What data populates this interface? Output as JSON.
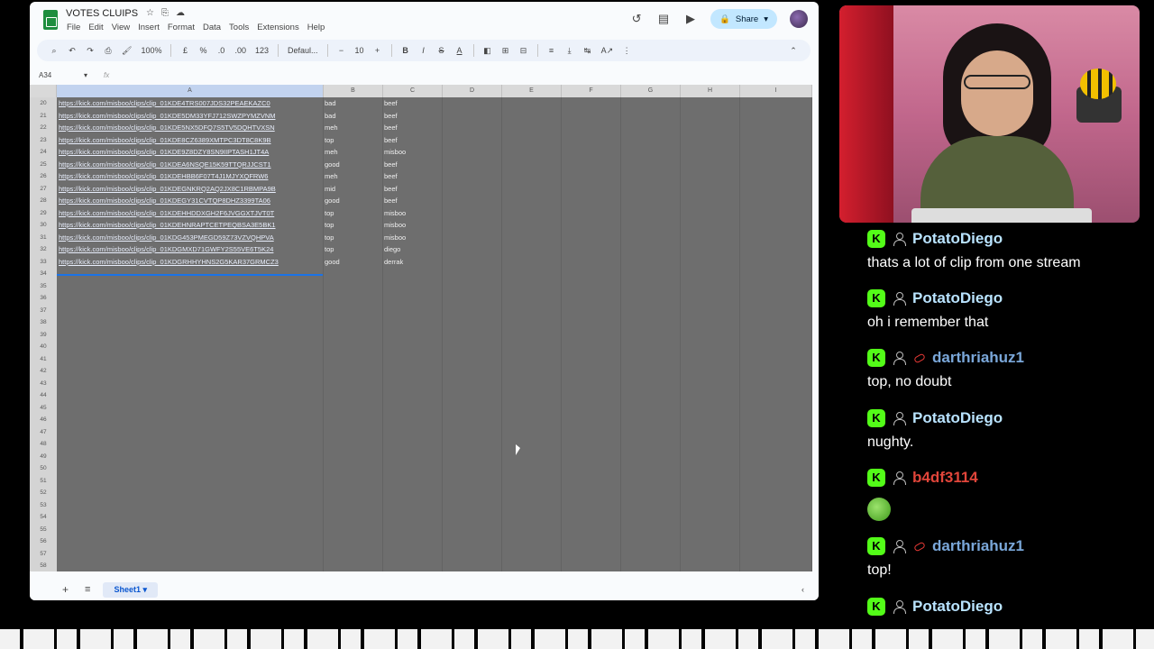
{
  "sheets": {
    "title": "VOTES CLUIPS",
    "menu": [
      "File",
      "Edit",
      "View",
      "Insert",
      "Format",
      "Data",
      "Tools",
      "Extensions",
      "Help"
    ],
    "share_label": "Share",
    "toolbar": {
      "zoom": "100%",
      "currency": "£",
      "percent": "%",
      "dec_decrease": ".0",
      "dec_increase": ".00",
      "number_format": "123",
      "font": "Defaul...",
      "font_minus": "−",
      "font_size": "10",
      "font_plus": "+",
      "bold": "B",
      "italic": "I",
      "strike": "S",
      "text_color": "A"
    },
    "name_box": "A34",
    "fx": "fx",
    "columns": [
      "A",
      "B",
      "C",
      "D",
      "E",
      "F",
      "G",
      "H",
      "I"
    ],
    "rows": [
      {
        "n": "20",
        "url": "https://kick.com/misboo/clips/clip_01KDE4TRS007JDS32PEAEKAZC0",
        "vote": "bad",
        "who": "beef"
      },
      {
        "n": "21",
        "url": "https://kick.com/misboo/clips/clip_01KDE5DM33YFJ712SWZPYMZVNM",
        "vote": "bad",
        "who": "beef"
      },
      {
        "n": "22",
        "url": "https://kick.com/misboo/clips/clip_01KDE5NX5DFQ7S5TV5DQHTVXSN",
        "vote": "meh",
        "who": "beef"
      },
      {
        "n": "23",
        "url": "https://kick.com/misboo/clips/clip_01KDE8CZ6389XMTPC3DT8C8K9B",
        "vote": "top",
        "who": "beef"
      },
      {
        "n": "24",
        "url": "https://kick.com/misboo/clips/clip_01KDE9Z8DZY8SN9IIPTASH1JT4A",
        "vote": "meh",
        "who": "misboo"
      },
      {
        "n": "25",
        "url": "https://kick.com/misboo/clips/clip_01KDEA6NSQE15K59TTQRJJCST1",
        "vote": "good",
        "who": "beef"
      },
      {
        "n": "26",
        "url": "https://kick.com/misboo/clips/clip_01KDEHBB6F07T4J1MJYXQFRW6",
        "vote": "meh",
        "who": "beef"
      },
      {
        "n": "27",
        "url": "https://kick.com/misboo/clips/clip_01KDEGNKRQ2AQ2JX8C1RBMPA9B",
        "vote": "mid",
        "who": "beef"
      },
      {
        "n": "28",
        "url": "https://kick.com/misboo/clips/clip_01KDEGY31CVTQP8DHZ3399TA06",
        "vote": "good",
        "who": "beef"
      },
      {
        "n": "29",
        "url": "https://kick.com/misboo/clips/clip_01KDEHHDDXGH2F6JVGGXTJVT0T",
        "vote": "top",
        "who": "misboo"
      },
      {
        "n": "30",
        "url": "https://kick.com/misboo/clips/clip_01KDEHNRAPTCETPEQBSA3E5BK1",
        "vote": "top",
        "who": "misboo"
      },
      {
        "n": "31",
        "url": "https://kick.com/misboo/clips/clip_01KDG453PMEGD59Z73VZVQHPVA",
        "vote": "top",
        "who": "misboo"
      },
      {
        "n": "32",
        "url": "https://kick.com/misboo/clips/clip_01KDGMXD71GWFY2S55VE6T5K24",
        "vote": "top",
        "who": "diego"
      },
      {
        "n": "33",
        "url": "https://kick.com/misboo/clips/clip_01KDGRHHYHNS2G5KAR37GRMCZ3",
        "vote": "good",
        "who": "derrak"
      }
    ],
    "empty_rows": [
      "34",
      "35",
      "36",
      "37",
      "38",
      "39",
      "40",
      "41",
      "42",
      "43",
      "44",
      "45",
      "46",
      "47",
      "48",
      "49",
      "50",
      "51",
      "52",
      "53",
      "54",
      "55",
      "56",
      "57",
      "58"
    ],
    "sheet_tab": "Sheet1"
  },
  "chat": {
    "messages": [
      {
        "user": "PotatoDiego",
        "color": "#b9e3ff",
        "text": "thats a lot of clip from one stream",
        "pill": false,
        "emote": false
      },
      {
        "user": "PotatoDiego",
        "color": "#b9e3ff",
        "text": "oh i remember that",
        "pill": false,
        "emote": false
      },
      {
        "user": "darthriahuz1",
        "color": "#7aa7d9",
        "text": "top, no doubt",
        "pill": true,
        "emote": false
      },
      {
        "user": "PotatoDiego",
        "color": "#b9e3ff",
        "text": "nughty.",
        "pill": false,
        "emote": false
      },
      {
        "user": "b4df3114",
        "color": "#e0453a",
        "text": "",
        "pill": false,
        "emote": true
      },
      {
        "user": "darthriahuz1",
        "color": "#7aa7d9",
        "text": "top!",
        "pill": true,
        "emote": false
      },
      {
        "user": "PotatoDiego",
        "color": "#b9e3ff",
        "text": "",
        "pill": false,
        "emote": false
      }
    ]
  }
}
